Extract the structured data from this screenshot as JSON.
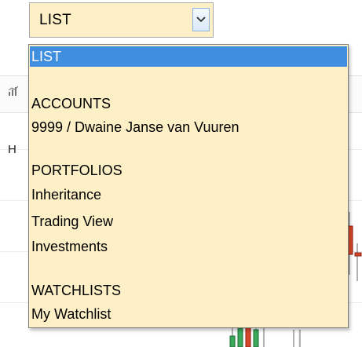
{
  "colors": {
    "select_background": "#fdefc6",
    "selected_option_background": "#3f8ee0",
    "selected_option_text": "#ffffff"
  },
  "icons": {
    "dropdown_arrow": "chevron-down-icon",
    "toolbar_chart": "chart-icon"
  },
  "background": {
    "ohlc_label": "H"
  },
  "select": {
    "value": "LIST"
  },
  "dropdown": {
    "selected": "LIST",
    "options": [
      {
        "label": "LIST",
        "kind": "option"
      },
      {
        "label": "",
        "kind": "spacer"
      },
      {
        "label": "ACCOUNTS",
        "kind": "group-heading"
      },
      {
        "label": "9999 / Dwaine Janse van Vuuren",
        "kind": "option"
      },
      {
        "label": "",
        "kind": "spacer"
      },
      {
        "label": "PORTFOLIOS",
        "kind": "group-heading"
      },
      {
        "label": "Inheritance",
        "kind": "option"
      },
      {
        "label": "Trading View",
        "kind": "option"
      },
      {
        "label": "Investments",
        "kind": "option"
      },
      {
        "label": "",
        "kind": "spacer"
      },
      {
        "label": "WATCHLISTS",
        "kind": "group-heading"
      },
      {
        "label": "My Watchlist",
        "kind": "option"
      }
    ]
  }
}
